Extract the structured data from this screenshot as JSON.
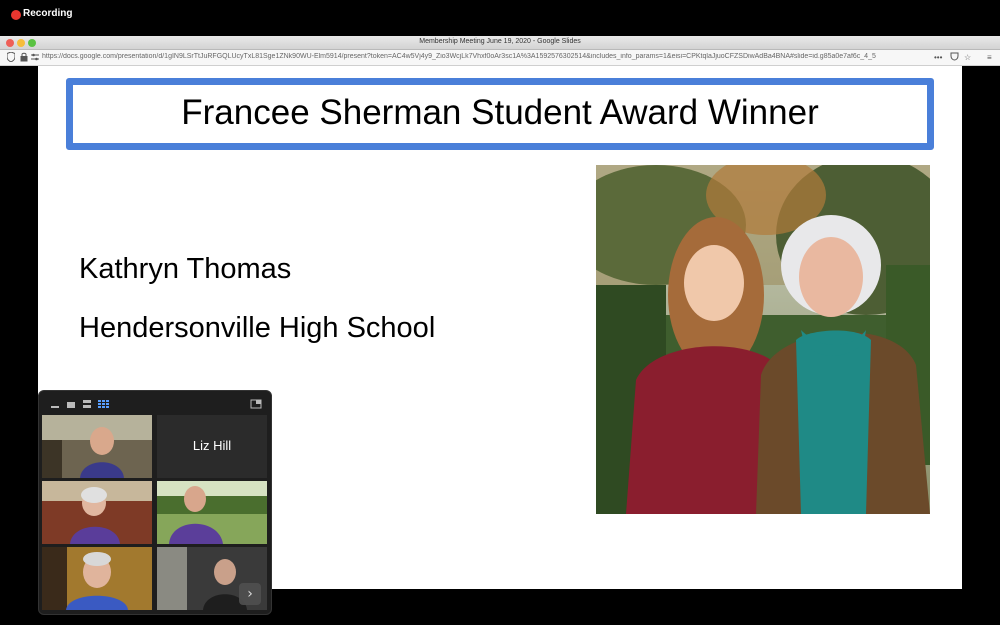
{
  "recording": {
    "label": "Recording"
  },
  "browser": {
    "window_title": "Membership Meeting June 19, 2020 - Google Slides",
    "url": "https://docs.google.com/presentation/d/1gIN9LSrTtJuRFGQLUcyTxL81Sge1ZNk90WU-Elm5914/present?token=AC4w5Vj4y9_Zio3WcjLk7Vhxf0oAr3sc1A%3A1592576302514&includes_info_params=1&eisi=CPKtqlaJjuoCFZSDiwAdBa4BNA#slide=id.g85a0e7af6c_4_5"
  },
  "slide": {
    "title": "Francee Sherman Student Award Winner",
    "name": "Kathryn Thomas",
    "school": "Hendersonville High School"
  },
  "gallery": {
    "participants": [
      {
        "name": ""
      },
      {
        "name": "Liz Hill"
      },
      {
        "name": ""
      },
      {
        "name": ""
      },
      {
        "name": ""
      },
      {
        "name": ""
      }
    ],
    "next_icon": "chevron-right-icon"
  },
  "colors": {
    "title_border": "#4a7fd9",
    "record_dot": "#e8362f"
  }
}
